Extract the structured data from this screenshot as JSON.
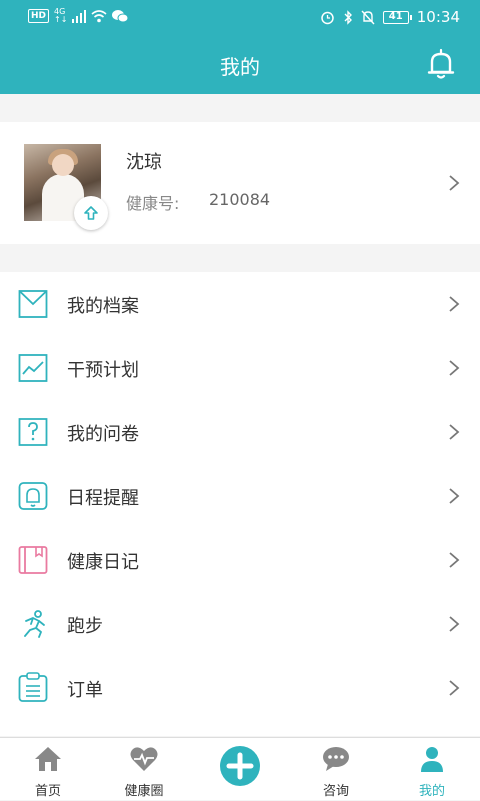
{
  "status_bar": {
    "hd": "HD",
    "network_type": "4G",
    "network_sub": "↑↓",
    "battery": "41",
    "time": "10:34"
  },
  "header": {
    "title": "我的"
  },
  "profile": {
    "name": "沈琼",
    "id_label": "健康号:",
    "id_value": "210084"
  },
  "menu": [
    {
      "label": "我的档案",
      "icon": "envelope-icon",
      "color": "#2fb3bd"
    },
    {
      "label": "干预计划",
      "icon": "line-chart-icon",
      "color": "#2fb3bd"
    },
    {
      "label": "我的问卷",
      "icon": "question-doc-icon",
      "color": "#2fb3bd"
    },
    {
      "label": "日程提醒",
      "icon": "bell-outline-icon",
      "color": "#2fb3bd"
    },
    {
      "label": "健康日记",
      "icon": "diary-book-icon",
      "color": "#e97aa0"
    },
    {
      "label": "跑步",
      "icon": "runner-icon",
      "color": "#2fb3bd"
    },
    {
      "label": "订单",
      "icon": "clipboard-icon",
      "color": "#2fb3bd"
    }
  ],
  "tabs": [
    {
      "label": "首页",
      "icon": "home-icon"
    },
    {
      "label": "健康圈",
      "icon": "heart-pulse-icon"
    },
    {
      "label": "",
      "icon": "plus-icon"
    },
    {
      "label": "咨询",
      "icon": "chat-icon"
    },
    {
      "label": "我的",
      "icon": "user-icon",
      "active": true
    }
  ],
  "colors": {
    "accent": "#2fb3bd",
    "pink": "#e97aa0",
    "inactive": "#888888"
  }
}
